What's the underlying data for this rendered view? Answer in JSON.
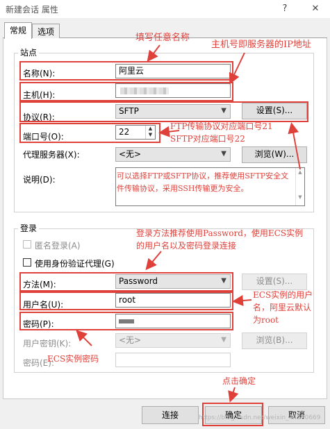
{
  "window": {
    "title": "新建会话 属性",
    "help_icon": "?",
    "close_icon": "✕"
  },
  "tabs": [
    {
      "label": "常规",
      "active": true
    },
    {
      "label": "选项",
      "active": false
    }
  ],
  "site": {
    "legend": "站点",
    "name_label": "名称(N):",
    "name_value": "阿里云",
    "host_label": "主机(H):",
    "protocol_label": "协议(R):",
    "protocol_value": "SFTP",
    "settings_button": "设置(S)...",
    "port_label": "端口号(O):",
    "port_value": "22",
    "proxy_label": "代理服务器(X):",
    "proxy_value": "<无>",
    "browse_button": "浏览(W)...",
    "desc_label": "说明(D):"
  },
  "login": {
    "legend": "登录",
    "anonymous_label": "匿名登录(A)",
    "agent_label": "使用身份验证代理(G)",
    "method_label": "方法(M):",
    "method_value": "Password",
    "settings_button": "设置(S)...",
    "username_label": "用户名(U):",
    "username_value": "root",
    "password_label": "密码(P):",
    "userkey_label": "用户密钥(K):",
    "userkey_value": "<无>",
    "browse_button": "浏览(B)...",
    "passphrase_label": "密码(E):"
  },
  "buttons": {
    "connect": "连接",
    "ok": "确定",
    "cancel": "取消"
  },
  "annotations": {
    "name_hint": "填写任意名称",
    "host_hint": "主机号即服务器的IP地址",
    "port_hint_1": "FTP传输协议对应端口号21",
    "port_hint_2": "SFTP对应端口号22",
    "protocol_hint_1": "可以选择FTP或SFTP协议，推荐使用SFTP安全文",
    "protocol_hint_2": "件传输协议，采用SSH传输更为安全。",
    "login_hint_1": "登录方法推荐使用Password，使用ECS实例",
    "login_hint_2": "的用户名以及密码登录连接",
    "user_hint_1": "ECS实例的用户",
    "user_hint_2": "名，阿里云默认",
    "user_hint_3": "为root",
    "password_hint": "ECS实例密码",
    "ok_hint": "点击确定"
  },
  "watermark": "https://blog.csdn.net/weixin_44580669",
  "colors": {
    "annotation": "#e0403a",
    "window_bg": "#f0f0f0"
  }
}
